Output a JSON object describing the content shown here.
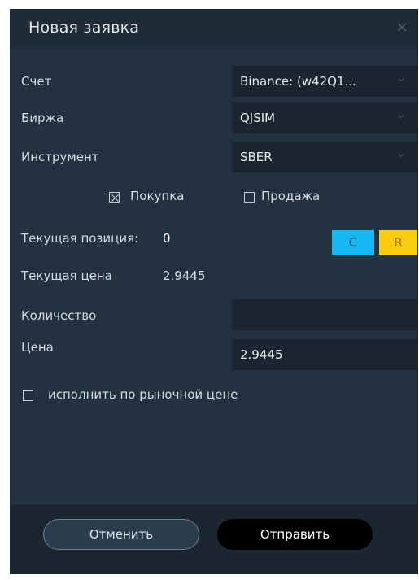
{
  "dialog": {
    "title": "Новая заявка",
    "close_glyph": "×"
  },
  "form": {
    "account_label": "Счет",
    "account_value": "Binance: (w42Q1...",
    "exchange_label": "Биржа",
    "exchange_value": "QJSIM",
    "instrument_label": "Инструмент",
    "instrument_value": "SBER",
    "buy_label": "Покупка",
    "buy_checked": true,
    "sell_label": "Продажа",
    "sell_checked": false,
    "position_label": "Текущая позиция:",
    "position_value": "0",
    "c_button_label": "C",
    "r_button_label": "R",
    "price_current_label": "Текущая цена",
    "price_current_value": "2.9445",
    "quantity_label": "Количество",
    "quantity_value": "",
    "price_label": "Цена",
    "price_value": "2.9445",
    "market_label": "исполнить по рыночной цене",
    "market_checked": false
  },
  "footer": {
    "cancel_label": "Отменить",
    "send_label": "Отправить"
  },
  "colors": {
    "window_bg": "#233240",
    "field_bg": "#1b2530",
    "c_button": "#16b8f3",
    "r_button": "#f9cd0d",
    "send_button": "#000000"
  },
  "icons": [
    "close-icon",
    "chevron-down-icon",
    "checkbox-checked-icon",
    "checkbox-unchecked-icon"
  ]
}
